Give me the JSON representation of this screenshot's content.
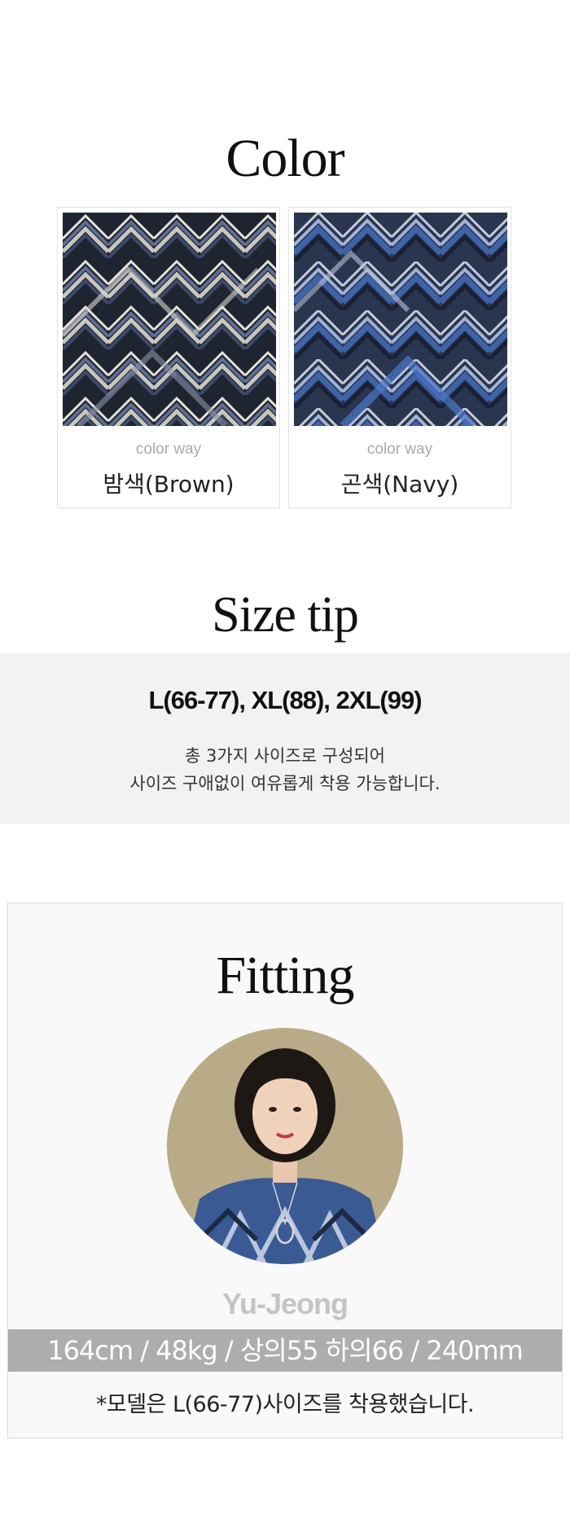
{
  "color_section": {
    "title": "Color",
    "swatches": [
      {
        "caption": "color way",
        "name": "밤색(Brown)"
      },
      {
        "caption": "color way",
        "name": "곤색(Navy)"
      }
    ]
  },
  "size_section": {
    "title": "Size tip",
    "headline": "L(66-77), XL(88), 2XL(99)",
    "desc_line1": "총 3가지 사이즈로 구성되어",
    "desc_line2": "사이즈 구애없이 여유롭게 착용 가능합니다."
  },
  "fitting_section": {
    "title": "Fitting",
    "model_name": "Yu-Jeong",
    "model_stats": "164cm / 48kg / 상의55 하의66 / 240mm",
    "model_note": "*모델은 L(66-77)사이즈를 착용했습니다."
  },
  "colors": {
    "band_bg": "#f2f2f2",
    "stats_bar": "#adadad",
    "swatch1_dark": "#1e2430",
    "swatch2_blue": "#3f63a8"
  }
}
